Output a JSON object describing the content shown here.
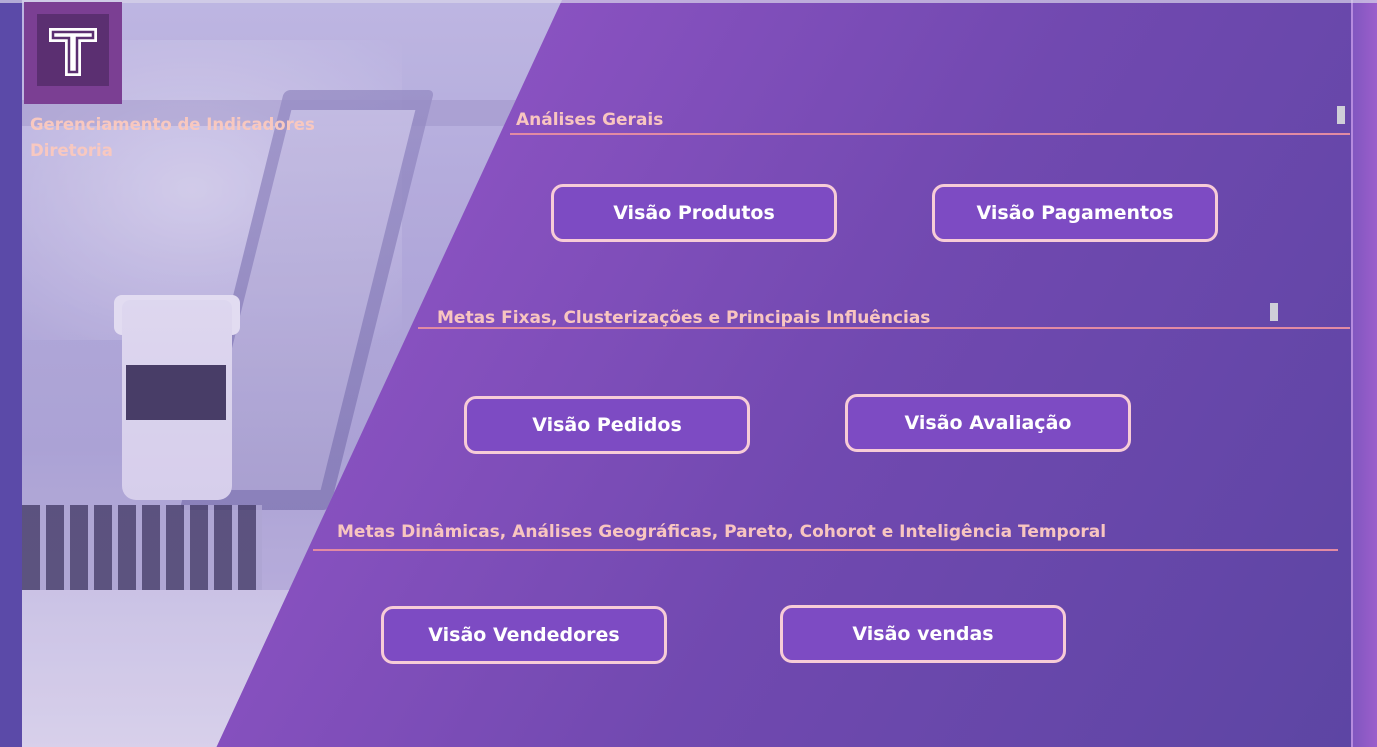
{
  "app": {
    "logo_letter": "T",
    "title_line1": "Gerenciamento de Indicadores",
    "title_line2": "Diretoria"
  },
  "sections": [
    {
      "title": "Análises Gerais",
      "buttons": [
        "Visão Produtos",
        "Visão Pagamentos"
      ]
    },
    {
      "title": "Metas Fixas, Clusterizações e Principais Influências",
      "buttons": [
        "Visão Pedidos",
        "Visão Avaliação"
      ]
    },
    {
      "title": "Metas Dinâmicas, Análises Geográficas, Pareto, Cohorot e Inteligência Temporal",
      "buttons": [
        "Visão Vendedores",
        "Visão vendas"
      ]
    }
  ],
  "colors": {
    "accent_text": "#f8c5c0",
    "button_fill": "#7d4bc3",
    "button_border": "#f7ccd7",
    "divider": "#e28aa3"
  }
}
